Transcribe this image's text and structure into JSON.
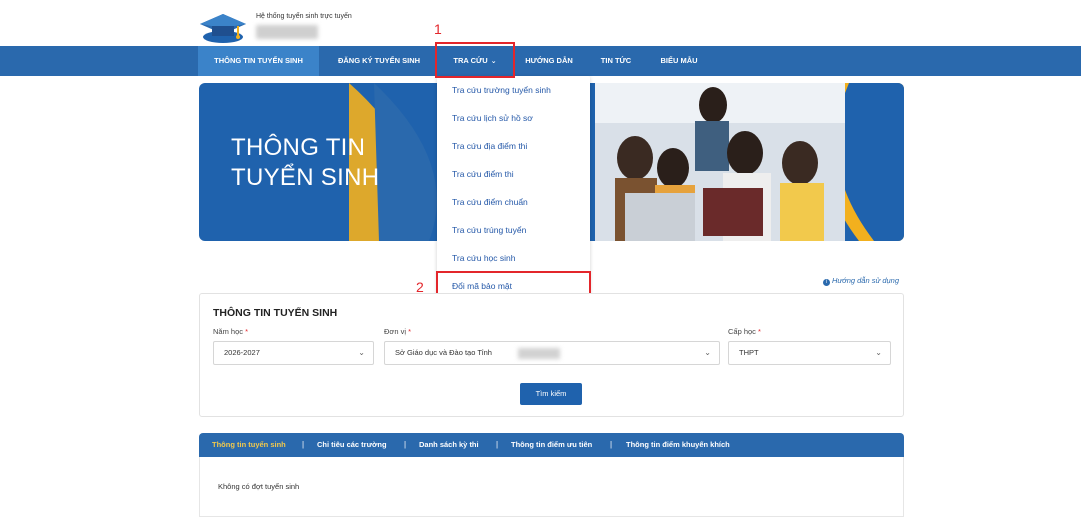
{
  "header": {
    "site_name": "Hệ thống tuyển sinh trực tuyến"
  },
  "nav": {
    "items": [
      {
        "label": "THÔNG TIN TUYỂN SINH"
      },
      {
        "label": "ĐĂNG KÝ TUYỂN SINH"
      },
      {
        "label": "TRA CỨU"
      },
      {
        "label": "HƯỚNG DẪN"
      },
      {
        "label": "TIN TỨC"
      },
      {
        "label": "BIỂU MẪU"
      }
    ],
    "active_index": 0
  },
  "banner": {
    "line1": "THÔNG TIN",
    "line2": "TUYỂN SINH"
  },
  "dropdown": {
    "items": [
      "Tra cứu trường tuyển sinh",
      "Tra cứu lịch sử hồ sơ",
      "Tra cứu địa điểm thi",
      "Tra cứu điểm thi",
      "Tra cứu điểm chuẩn",
      "Tra cứu trúng tuyển",
      "Tra cứu học sinh",
      "Đổi mã bảo mật"
    ]
  },
  "annotations": {
    "step1": "1",
    "step2": "2",
    "color": "#e3262b"
  },
  "help_link": "Hướng dẫn sử dụng",
  "search_panel": {
    "title": "THÔNG TIN TUYỂN SINH",
    "year_label": "Năm học",
    "year_value": "2026-2027",
    "unit_label": "Đơn vị",
    "unit_value": "Sở Giáo dục và Đào tạo Tỉnh",
    "level_label": "Cấp học",
    "level_value": "THPT",
    "required_mark": "*",
    "search_button": "Tìm kiếm"
  },
  "tabs": {
    "items": [
      "Thông tin tuyển sinh",
      "Chỉ tiêu các trường",
      "Danh sách kỳ thi",
      "Thông tin điểm ưu tiên",
      "Thông tin điểm khuyến khích"
    ],
    "separator": "|",
    "empty_message": "Không có đợt tuyển sinh"
  },
  "colors": {
    "primary": "#2a69ad",
    "active_tab_text": "#f2c94c",
    "link": "#2458a8"
  },
  "icons": {
    "logo": "graduation-cap-icon",
    "chevron": "chevron-down-icon",
    "info": "info-circle-icon"
  }
}
